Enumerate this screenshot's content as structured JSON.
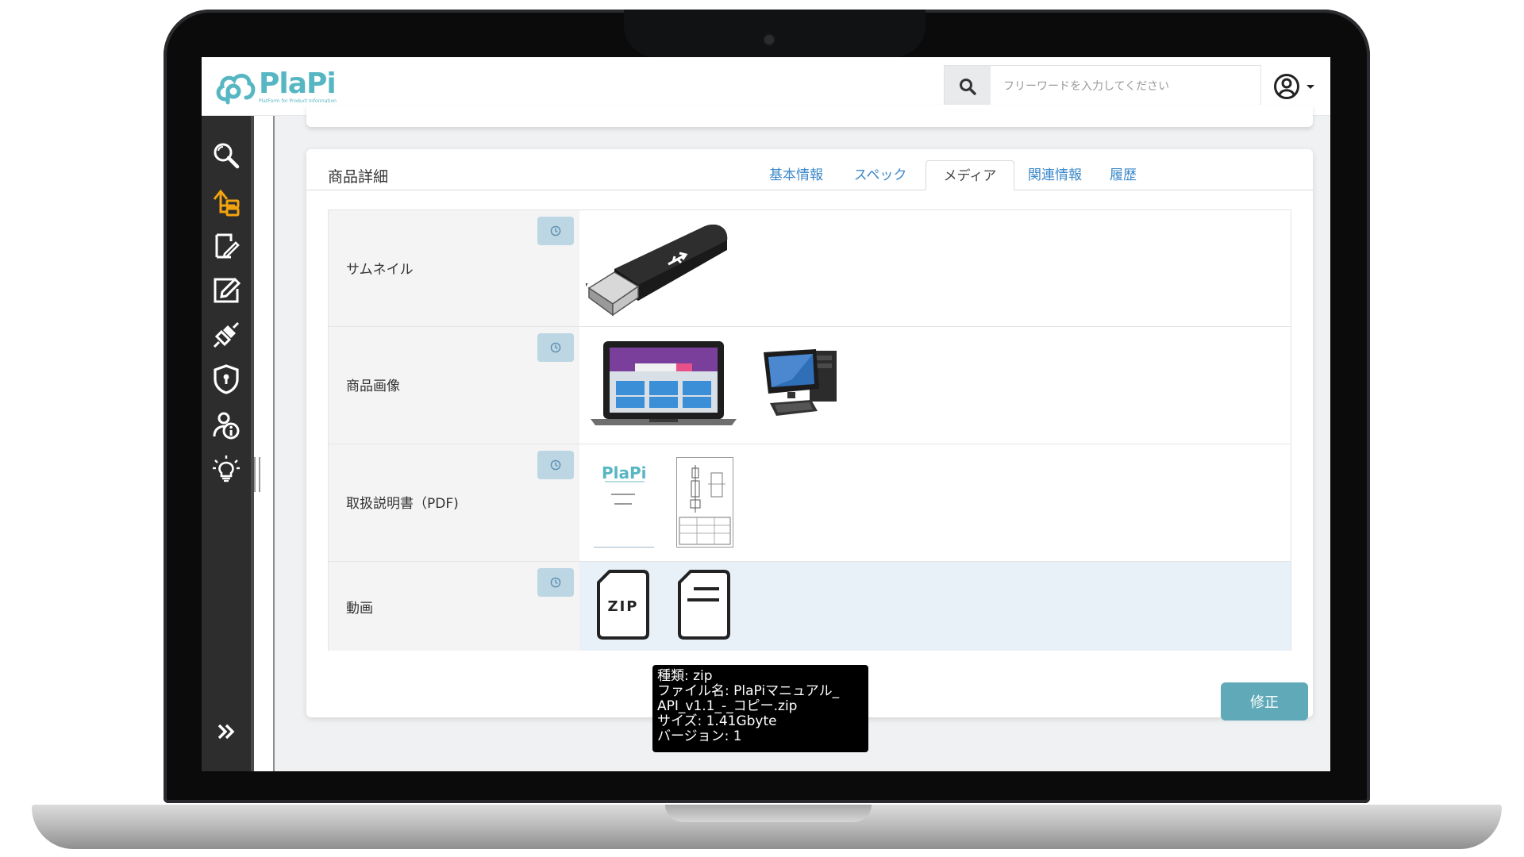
{
  "app": {
    "logo_text": "PlaPi",
    "logo_tagline": "PlatForm for Product Information",
    "brand_color": "#56b7c3"
  },
  "search": {
    "placeholder": "フリーワードを入力してください",
    "value": ""
  },
  "sidebar": {
    "items": [
      {
        "icon": "magnifier-icon"
      },
      {
        "icon": "upload-tree-icon",
        "active": true,
        "color": "#f2a30f"
      },
      {
        "icon": "document-edit-icon"
      },
      {
        "icon": "pencil-box-icon"
      },
      {
        "icon": "plug-icon"
      },
      {
        "icon": "shield-lock-icon"
      },
      {
        "icon": "user-info-icon"
      },
      {
        "icon": "lightbulb-icon"
      }
    ],
    "expand_icon": "double-chevron-right-icon"
  },
  "card": {
    "title": "商品詳細",
    "tabs": [
      {
        "label": "基本情報",
        "active": false
      },
      {
        "label": "スペック",
        "active": false
      },
      {
        "label": "メディア",
        "active": true
      },
      {
        "label": "関連情報",
        "active": false
      },
      {
        "label": "履歴",
        "active": false
      }
    ]
  },
  "media": {
    "rows": [
      {
        "label": "サムネイル",
        "items": [
          "usb-flash-drive-image"
        ]
      },
      {
        "label": "商品画像",
        "items": [
          "laptop-image",
          "desktop-pc-image"
        ]
      },
      {
        "label": "取扱説明書（PDF)",
        "items": [
          "plapi-manual-pdf-thumb",
          "drawing-pdf-thumb"
        ],
        "pdf_logo_text": "PlaPi"
      },
      {
        "label": "動画",
        "items": [
          "zip-file-icon",
          "document-file-icon"
        ],
        "zip_label": "ZIP",
        "highlighted": true
      }
    ]
  },
  "tooltip": {
    "line1": "種類: zip",
    "line2": "ファイル名: PlaPiマニュアル_",
    "line3": "API_v1.1_-_コピー.zip",
    "line4": "サイズ: 1.41Gbyte",
    "line5": "バージョン: 1"
  },
  "actions": {
    "edit_label": "修正",
    "edit_color": "#5fa9b8"
  }
}
